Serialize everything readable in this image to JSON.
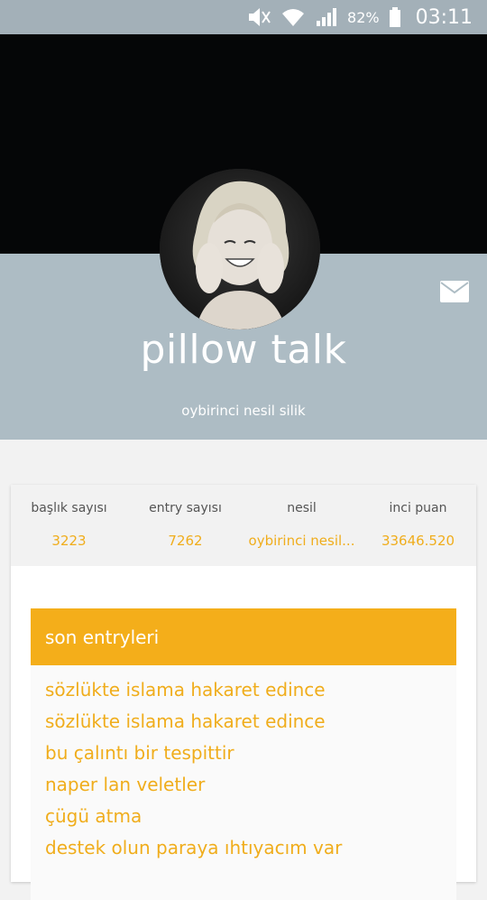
{
  "status_bar": {
    "battery_percent": "82%",
    "time": "03:11",
    "icons": [
      "mute-icon",
      "wifi-icon",
      "signal-icon",
      "battery-icon"
    ]
  },
  "profile": {
    "username": "pillow talk",
    "subtitle": "oybirinci nesil silik"
  },
  "stats": [
    {
      "label": "başlık sayısı",
      "value": "3223"
    },
    {
      "label": "entry sayısı",
      "value": "7262"
    },
    {
      "label": "nesil",
      "value": "oybirinci nesil..."
    },
    {
      "label": "inci puan",
      "value": "33646.520"
    }
  ],
  "recent_entries": {
    "title": "son entryleri",
    "items": [
      "sözlükte islama hakaret edince",
      "sözlükte islama hakaret edince",
      "bu çalıntı bir tespittir",
      "naper lan veletler",
      "çügü atma",
      "destek olun paraya ıhtıyacım var"
    ]
  },
  "colors": {
    "accent": "#f4ae1a",
    "band": "#adbcc4",
    "status_bar": "#a3b0b8"
  }
}
